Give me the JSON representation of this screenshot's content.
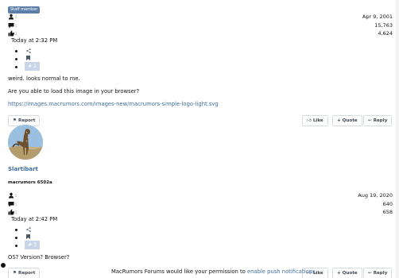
{
  "post1": {
    "badge": "Staff member",
    "joined": "Apr 9, 2001",
    "messages": "15,763",
    "reactions": "4,624",
    "time": "Today at 2:32 PM",
    "number": "# 2",
    "body_line1": "weird. looks normal to me.",
    "body_line2": "Are you able to load this image in your browser?",
    "link": "https://images.macrumors.com/images-new/macrumors-simple-logo-light.svg"
  },
  "actions": {
    "report": "Report",
    "like": "Like",
    "quote": "+ Quote",
    "reply": "Reply"
  },
  "post2": {
    "username": "Slartibart",
    "usertitle": "macrumors 6502a",
    "joined": "Aug 19, 2020",
    "messages": "640",
    "reactions": "658",
    "time": "Today at 2:42 PM",
    "number": "# 3",
    "body": "OS? Version? Browser?"
  },
  "notice": {
    "text": "MacRumors Forums would like your permission to ",
    "link": "enable push notifications",
    "end": "."
  },
  "colon": ":"
}
